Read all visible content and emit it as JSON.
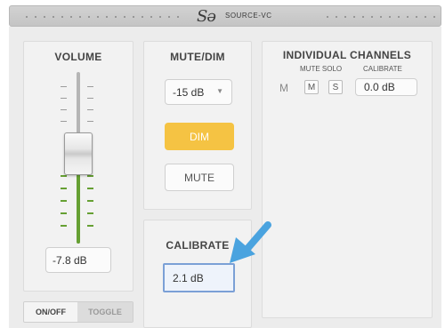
{
  "header": {
    "logo": "Sǝ",
    "brand": "SOURCE-VC"
  },
  "volume": {
    "title": "VOLUME",
    "value": "-7.8 dB"
  },
  "mute_dim": {
    "title": "MUTE/DIM",
    "dim_level": "-15 dB",
    "dim_label": "DIM",
    "mute_label": "MUTE"
  },
  "calibrate": {
    "title": "CALIBRATE",
    "value": "2.1 dB"
  },
  "channels": {
    "title": "INDIVIDUAL CHANNELS",
    "headers": {
      "mute_solo": "MUTE SOLO",
      "calibrate": "CALIBRATE"
    },
    "rows": [
      {
        "channel": "M",
        "mute": "M",
        "solo": "S",
        "calibrate": "0.0 dB"
      }
    ]
  },
  "onoff": {
    "on_label": "ON/OFF",
    "toggle_label": "TOGGLE"
  },
  "colors": {
    "dim_active": "#f5c343",
    "highlight": "#4a90d9",
    "arrow": "#4aa3df",
    "meter_green": "#66a033"
  }
}
